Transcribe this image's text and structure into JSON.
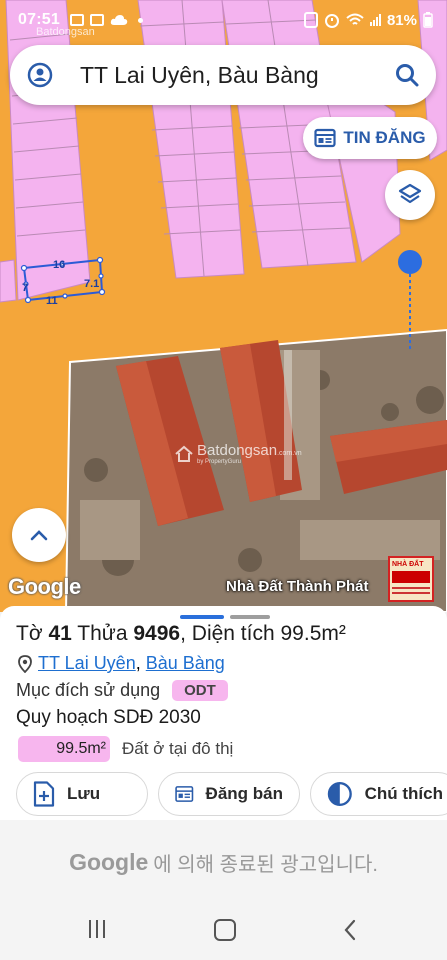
{
  "status_bar": {
    "time": "07:51",
    "battery": "81%"
  },
  "map": {
    "search": {
      "query": "TT Lai Uyên, Bàu Bàng"
    },
    "tin_dang_label": "TIN ĐĂNG",
    "parcel_dims": {
      "top": "16",
      "left": "7",
      "right": "7.1",
      "bottom": "11"
    },
    "watermark": "Batdongsan",
    "watermark_by": "by PropertyGuru",
    "watermark_suffix": ".com.vn",
    "google_logo": "Google",
    "photo_caption": "Nhà Đất Thành Phát",
    "ad_thumb_text": "NHÀ ĐẤT"
  },
  "parcel": {
    "to_label": "Tờ",
    "to_number": "41",
    "thua_label": "Thửa",
    "thua_number": "9496",
    "area_label": "Diện tích",
    "area_value": "99.5m²",
    "location_town": "TT Lai Uyên",
    "location_separator": ",",
    "location_district": "Bàu Bàng",
    "purpose_label": "Mục đích sử dụng",
    "purpose_code": "ODT",
    "plan_title": "Quy hoạch SDĐ 2030",
    "plan_area": "99.5m²",
    "plan_description": "Đất ở tại đô thị"
  },
  "actions": {
    "save_label": "Lưu",
    "sell_label": "Đăng bán",
    "legend_label": "Chú thích"
  },
  "ad_banner": {
    "brand": "Google",
    "text": "에 의해 종료된 광고입니다."
  },
  "colors": {
    "map_orange": "#f4a63a",
    "parcel_pink": "#f7b6ee",
    "accent_blue": "#1e6fd0"
  }
}
